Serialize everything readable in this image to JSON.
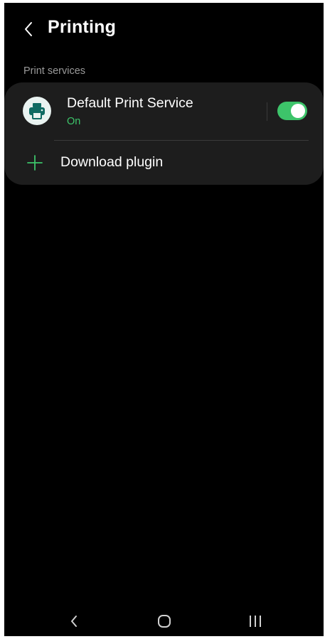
{
  "header": {
    "title": "Printing",
    "back_icon": "chevron-left-icon"
  },
  "section": {
    "title": "Print services"
  },
  "service": {
    "name": "Default Print Service",
    "status": "On",
    "icon": "printer-icon",
    "enabled": true
  },
  "download": {
    "label": "Download plugin",
    "icon": "plus-icon"
  },
  "navbar": {
    "back_icon": "nav-back-icon",
    "home_icon": "nav-home-icon",
    "recents_icon": "nav-recents-icon"
  },
  "colors": {
    "background": "#000000",
    "card": "#1d1d1d",
    "accent": "#3dc46a",
    "icon_teal": "#0f6b63",
    "section_text": "#9a9a9a"
  }
}
